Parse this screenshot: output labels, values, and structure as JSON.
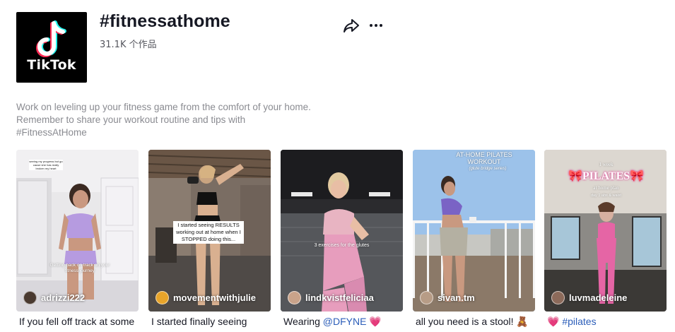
{
  "header": {
    "logo_text": "TikTok",
    "title": "#fitnessathome",
    "count": "31.1K 个作品"
  },
  "description": {
    "line1": "Work on leveling up your fitness game from the comfort of your home.",
    "line2": "Remember to share your workout routine and tips with",
    "line3": "#FitnessAtHome"
  },
  "colors": {
    "accent_pink": "#fe2c55",
    "accent_cyan": "#25f4ee",
    "hashtag_link": "#2b5db9",
    "muted_text": "#8a8b91"
  },
  "videos": [
    {
      "overlay_top": "seeing my progress but go cause she has really broken my heart",
      "overlay_mid": "Getting back on track on your fitness journey",
      "author": "adrizzi222",
      "caption": "If you fell off track at some"
    },
    {
      "overlay_top": "I started seeing RESULTS working out at home when I STOPPED doing this...",
      "author": "movementwithjulie",
      "caption": "I started finally seeing"
    },
    {
      "overlay_mid": "3 exercises for the glutes",
      "author": "lindkvistfeliciaa",
      "caption_prefix": "Wearing ",
      "caption_tag": "@DFYNE",
      "caption_suffix": " 💗"
    },
    {
      "overlay_top": "AT-HOME PILATES WORKOUT",
      "overlay_sub": "(glute bridge series)",
      "author": "sivan.tm",
      "caption": "all you need is a stool! 🧸"
    },
    {
      "overlay_top": "1 week",
      "overlay_big": "🎀PILATES🎀",
      "overlay_sub": "at home plan",
      "overlay_small": "day 1 abs & waist",
      "author": "luvmadeleine",
      "caption_prefix": "💗 ",
      "caption_tag": "#pilates"
    }
  ]
}
